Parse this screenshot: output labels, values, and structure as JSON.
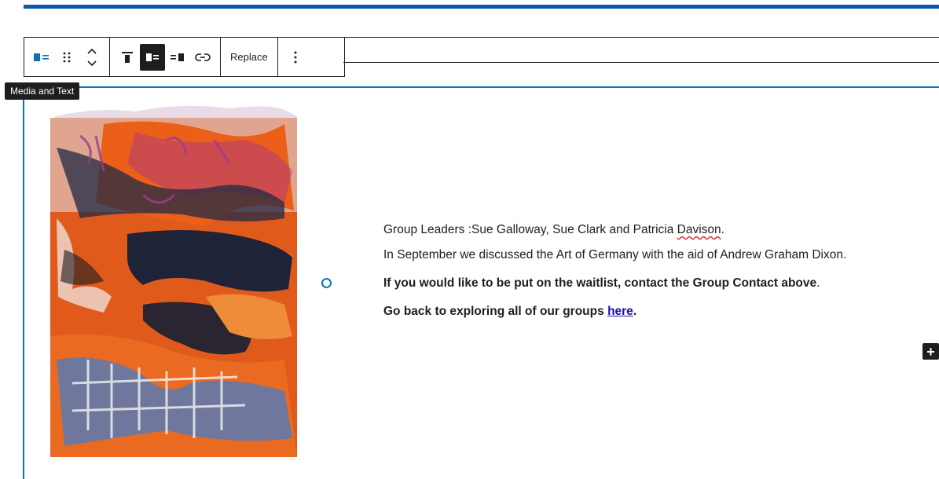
{
  "toolbar": {
    "block_type_icon": "media-text-icon",
    "drag_icon": "drag-handle-icon",
    "move_icon": "move-up-down-icon",
    "align_top_icon": "align-top-icon",
    "media_left_icon": "media-left-icon",
    "media_right_icon": "media-right-icon",
    "link_icon": "link-icon",
    "replace_label": "Replace",
    "more_icon": "more-options-icon"
  },
  "tooltip": {
    "text": "Media and Text"
  },
  "content": {
    "leaders_text": "Group Leaders :Sue Galloway, Sue Clark and Patricia ",
    "leaders_name_flagged": "Davison",
    "leaders_end": ".",
    "september_text": "In September we discussed the Art of Germany with the aid of Andrew Graham Dixon.",
    "waitlist_text": "If you would like to be put on the waitlist, contact the Group Contact above",
    "waitlist_end": ".",
    "explore_text": "Go back to exploring all of our groups ",
    "explore_link": "here",
    "explore_end": "."
  },
  "inserter": {
    "label": "+"
  },
  "colors": {
    "accent": "#0a73b8",
    "top_bar": "#0a58a8",
    "dark": "#1e1e1e"
  }
}
